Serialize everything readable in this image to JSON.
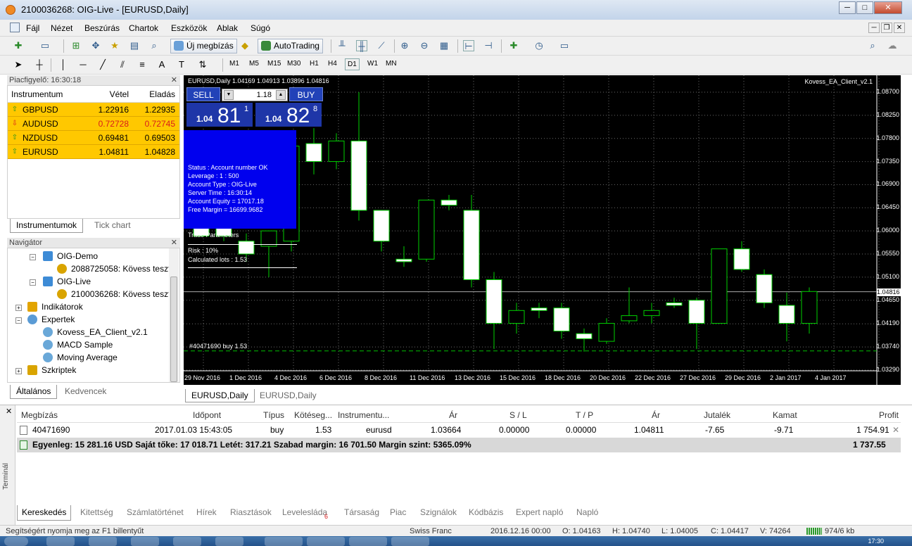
{
  "window": {
    "title": "2100036268: OIG-Live - [EURUSD,Daily]"
  },
  "menu": [
    "Fájl",
    "Nézet",
    "Beszúrás",
    "Chartok",
    "Eszközök",
    "Ablak",
    "Súgó"
  ],
  "toolbar": {
    "new_order": "Új megbízás",
    "autotrading": "AutoTrading",
    "timeframes": [
      "M1",
      "M5",
      "M15",
      "M30",
      "H1",
      "H4",
      "D1",
      "W1",
      "MN"
    ]
  },
  "market_watch": {
    "title": "Piacfigyelő: 16:30:18",
    "headers": {
      "symbol": "Instrumentum",
      "bid": "Vétel",
      "ask": "Eladás"
    },
    "rows": [
      {
        "symbol": "GBPUSD",
        "bid": "1.22916",
        "ask": "1.22935",
        "dir": "up"
      },
      {
        "symbol": "AUDUSD",
        "bid": "0.72728",
        "ask": "0.72745",
        "dir": "down"
      },
      {
        "symbol": "NZDUSD",
        "bid": "0.69481",
        "ask": "0.69503",
        "dir": "up"
      },
      {
        "symbol": "EURUSD",
        "bid": "1.04811",
        "ask": "1.04828",
        "dir": "up"
      }
    ],
    "tabs": [
      "Instrumentumok",
      "Tick chart"
    ]
  },
  "navigator": {
    "title": "Navigátor",
    "items": [
      "OIG-Demo",
      "2088725058: Kövess teszt",
      "OIG-Live",
      "2100036268: Kövess teszt",
      "Indikátorok",
      "Expertek",
      "Kovess_EA_Client_v2.1",
      "MACD Sample",
      "Moving Average",
      "Szkriptek"
    ],
    "tabs": [
      "Általános",
      "Kedvencek"
    ]
  },
  "chart": {
    "info": "EURUSD,Daily  1.04169 1.04913 1.03896 1.04816",
    "ea_label": "Kovess_EA_Client_v2.1",
    "sell_label": "SELL",
    "buy_label": "BUY",
    "lot": "1.18",
    "sell_price": {
      "small": "1.04",
      "large": "81",
      "sup": "1"
    },
    "buy_price": {
      "small": "1.04",
      "large": "82",
      "sup": "8"
    },
    "status_lines": [
      "Status   :   Account number OK",
      "Leverage  :  1 : 500",
      "Account Type  :  OIG-Live",
      "Server Time  :  16:30:14",
      "Account Equity  =  17017.18",
      "Free Margin    =  16699.9682"
    ],
    "trade_params": "Trade Parameters",
    "risk_lines": [
      "Risk              :   10%",
      "Calculated lots   :   1.53"
    ],
    "order_tag": "#40471690 buy 1.53",
    "current_price": "1.04816",
    "tabs": [
      "EURUSD,Daily",
      "EURUSD,Daily"
    ]
  },
  "chart_data": {
    "type": "candlestick",
    "x_labels": [
      "29 Nov 2016",
      "1 Dec 2016",
      "4 Dec 2016",
      "6 Dec 2016",
      "8 Dec 2016",
      "11 Dec 2016",
      "13 Dec 2016",
      "15 Dec 2016",
      "18 Dec 2016",
      "20 Dec 2016",
      "22 Dec 2016",
      "27 Dec 2016",
      "29 Dec 2016",
      "2 Jan 2017",
      "4 Jan 2017"
    ],
    "y_ticks": [
      "1.08700",
      "1.08250",
      "1.07800",
      "1.07350",
      "1.06900",
      "1.06450",
      "1.06000",
      "1.05550",
      "1.05100",
      "1.04650",
      "1.04190",
      "1.03740",
      "1.03290"
    ],
    "ylim": [
      1.0329,
      1.087
    ],
    "candles": [
      {
        "o": 1.063,
        "h": 1.066,
        "l": 1.059,
        "c": 1.059
      },
      {
        "o": 1.0625,
        "h": 1.066,
        "l": 1.058,
        "c": 1.059
      },
      {
        "o": 1.058,
        "h": 1.0595,
        "l": 1.054,
        "c": 1.0555
      },
      {
        "o": 1.057,
        "h": 1.059,
        "l": 1.051,
        "c": 1.06
      },
      {
        "o": 1.058,
        "h": 1.079,
        "l": 1.056,
        "c": 1.0765
      },
      {
        "o": 1.077,
        "h": 1.08,
        "l": 1.071,
        "c": 1.0735
      },
      {
        "o": 1.0735,
        "h": 1.079,
        "l": 1.072,
        "c": 1.0775
      },
      {
        "o": 1.0775,
        "h": 1.087,
        "l": 1.062,
        "c": 1.064
      },
      {
        "o": 1.064,
        "h": 1.064,
        "l": 1.056,
        "c": 1.058
      },
      {
        "o": 1.0545,
        "h": 1.057,
        "l": 1.053,
        "c": 1.054
      },
      {
        "o": 1.0545,
        "h": 1.066,
        "l": 1.054,
        "c": 1.066
      },
      {
        "o": 1.066,
        "h": 1.067,
        "l": 1.064,
        "c": 1.065
      },
      {
        "o": 1.064,
        "h": 1.067,
        "l": 1.049,
        "c": 1.0505
      },
      {
        "o": 1.0505,
        "h": 1.052,
        "l": 1.037,
        "c": 1.042
      },
      {
        "o": 1.042,
        "h": 1.046,
        "l": 1.04,
        "c": 1.0445
      },
      {
        "o": 1.045,
        "h": 1.046,
        "l": 1.043,
        "c": 1.0445
      },
      {
        "o": 1.045,
        "h": 1.046,
        "l": 1.039,
        "c": 1.0405
      },
      {
        "o": 1.04,
        "h": 1.041,
        "l": 1.0365,
        "c": 1.039
      },
      {
        "o": 1.0385,
        "h": 1.043,
        "l": 1.038,
        "c": 1.042
      },
      {
        "o": 1.0425,
        "h": 1.049,
        "l": 1.042,
        "c": 1.0435
      },
      {
        "o": 1.0435,
        "h": 1.046,
        "l": 1.042,
        "c": 1.0445
      },
      {
        "o": 1.046,
        "h": 1.047,
        "l": 1.045,
        "c": 1.0455
      },
      {
        "o": 1.0465,
        "h": 1.047,
        "l": 1.037,
        "c": 1.042
      },
      {
        "o": 1.042,
        "h": 1.0565,
        "l": 1.042,
        "c": 1.0565
      },
      {
        "o": 1.0565,
        "h": 1.058,
        "l": 1.052,
        "c": 1.0525
      },
      {
        "o": 1.0515,
        "h": 1.0525,
        "l": 1.045,
        "c": 1.046
      },
      {
        "o": 1.0455,
        "h": 1.048,
        "l": 1.0385,
        "c": 1.042
      },
      {
        "o": 1.042,
        "h": 1.049,
        "l": 1.04,
        "c": 1.0482
      }
    ]
  },
  "terminal": {
    "headers": [
      "Megbízás",
      "Időpont",
      "Típus",
      "Kötéseg...",
      "Instrumentu...",
      "Ár",
      "S / L",
      "T / P",
      "Ár",
      "Jutalék",
      "Kamat",
      "Profit"
    ],
    "order": [
      "40471690",
      "2017.01.03 15:43:05",
      "buy",
      "1.53",
      "eurusd",
      "1.03664",
      "0.00000",
      "0.00000",
      "1.04811",
      "-7.65",
      "-9.71",
      "1 754.91"
    ],
    "balance": "Egyenleg: 15 281.16 USD  Saját tőke: 17 018.71  Letét: 317.21  Szabad margin: 16 701.50  Margin szint: 5365.09%",
    "balance_profit": "1 737.55",
    "side_label": "Terminál",
    "tabs": [
      "Kereskedés",
      "Kitettség",
      "Számlatörténet",
      "Hírek",
      "Riasztások",
      "Levelesláda",
      "Társaság",
      "Piac",
      "Szignálok",
      "Kódbázis",
      "Expert napló",
      "Napló"
    ],
    "mail_badge": "6"
  },
  "statusbar": {
    "help": "Segítségért nyomja meg az F1 billentyűt",
    "profile": "Swiss Franc",
    "time": "2016.12.16 00:00",
    "o": "O: 1.04163",
    "h": "H: 1.04740",
    "l": "L: 1.04005",
    "c": "C: 1.04417",
    "v": "V: 74264",
    "conn": "974/6 kb"
  },
  "taskbar": {
    "clock": "17:30"
  },
  "colors": {
    "bull": "#00d000",
    "bear_fill": "#ffffff",
    "watch_bg": "#ffc800",
    "chart_bg": "#000000",
    "panel_blue": "#0000ee"
  }
}
